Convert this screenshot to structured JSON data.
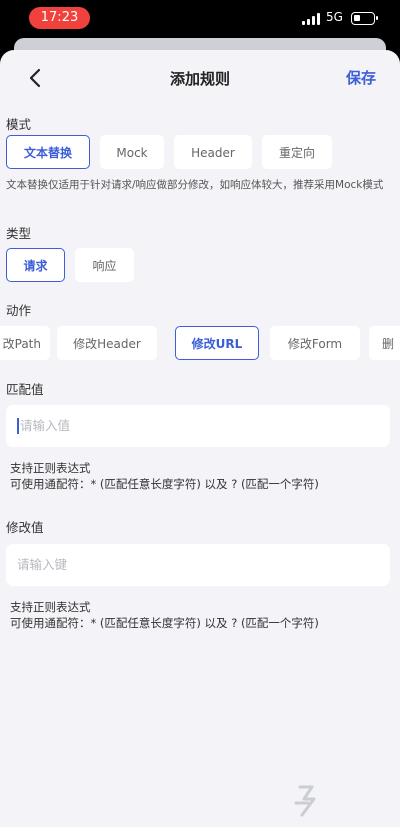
{
  "status_bar": {
    "time": "17:23",
    "network": "5G",
    "battery_level": 0.35
  },
  "nav": {
    "title": "添加规则",
    "save_label": "保存",
    "back_icon": "chevron-left-icon"
  },
  "mode": {
    "label": "模式",
    "options": [
      "文本替换",
      "Mock",
      "Header",
      "重定向"
    ],
    "selected": "文本替换",
    "hint": "文本替换仅适用于针对请求/响应做部分修改，如响应体较大，推荐采用Mock模式"
  },
  "type": {
    "label": "类型",
    "options": [
      "请求",
      "响应"
    ],
    "selected": "请求"
  },
  "action": {
    "label": "动作",
    "options": [
      "改Path",
      "修改Header",
      "修改URL",
      "修改Form",
      "删"
    ],
    "selected": "修改URL"
  },
  "match_value": {
    "label": "匹配值",
    "placeholder": "请输入值",
    "help_line1": "支持正则表达式",
    "help_line2": "可使用通配符：* (匹配任意长度字符) 以及 ? (匹配一个字符)"
  },
  "modify_value": {
    "label": "修改值",
    "placeholder": "请输入键",
    "help_line1": "支持正则表达式",
    "help_line2": "可使用通配符：* (匹配任意长度字符) 以及 ? (匹配一个字符)"
  },
  "watermark": {
    "text": "九游"
  },
  "colors": {
    "accent": "#3d5ed6",
    "background": "#f3f3f8",
    "time_pill": "#f0413c"
  }
}
